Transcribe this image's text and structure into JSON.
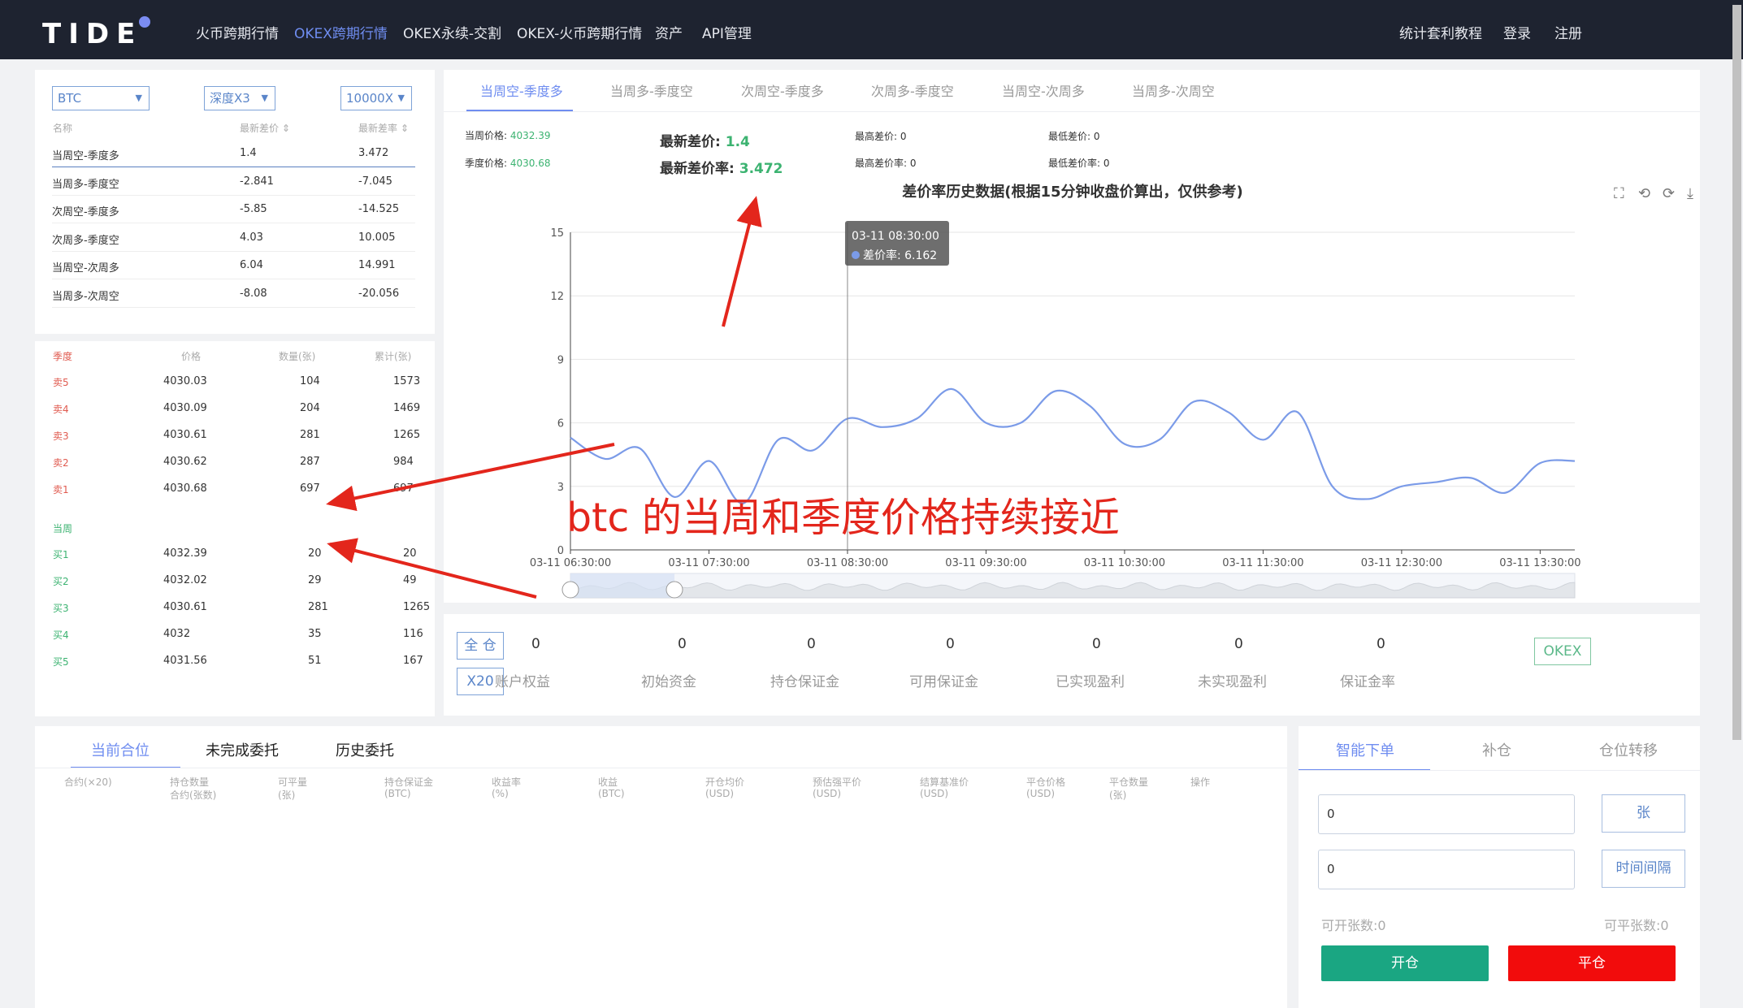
{
  "header": {
    "logo": "TIDE",
    "nav": [
      "火币跨期行情",
      "OKEX跨期行情",
      "OKEX永续-交割",
      "OKEX-火币跨期行情",
      "资产",
      "API管理"
    ],
    "active_nav": 1,
    "right": [
      "统计套利教程",
      "登录",
      "注册"
    ]
  },
  "spread_table": {
    "selects": {
      "coin": "BTC",
      "depth": "深度X3",
      "amount": "10000X"
    },
    "headers": [
      "名称",
      "最新差价 ⇕",
      "最新差率 ⇕"
    ],
    "rows": [
      {
        "name": "当周空-季度多",
        "diff": "1.4",
        "rate": "3.472"
      },
      {
        "name": "当周多-季度空",
        "diff": "-2.841",
        "rate": "-7.045"
      },
      {
        "name": "次周空-季度多",
        "diff": "-5.85",
        "rate": "-14.525"
      },
      {
        "name": "次周多-季度空",
        "diff": "4.03",
        "rate": "10.005"
      },
      {
        "name": "当周空-次周多",
        "diff": "6.04",
        "rate": "14.991"
      },
      {
        "name": "当周多-次周空",
        "diff": "-8.08",
        "rate": "-20.056"
      }
    ]
  },
  "orderbook": {
    "headers": [
      "季度",
      "价格",
      "数量(张)",
      "累计(张)"
    ],
    "asks": [
      {
        "label": "卖5",
        "price": "4030.03",
        "qty": "104",
        "total": "1573"
      },
      {
        "label": "卖4",
        "price": "4030.09",
        "qty": "204",
        "total": "1469"
      },
      {
        "label": "卖3",
        "price": "4030.61",
        "qty": "281",
        "total": "1265"
      },
      {
        "label": "卖2",
        "price": "4030.62",
        "qty": "287",
        "total": "984"
      },
      {
        "label": "卖1",
        "price": "4030.68",
        "qty": "697",
        "total": "697"
      }
    ],
    "mid_label": "当周",
    "bids": [
      {
        "label": "买1",
        "price": "4032.39",
        "qty": "20",
        "total": "20"
      },
      {
        "label": "买2",
        "price": "4032.02",
        "qty": "29",
        "total": "49"
      },
      {
        "label": "买3",
        "price": "4030.61",
        "qty": "281",
        "total": "1265"
      },
      {
        "label": "买4",
        "price": "4032",
        "qty": "35",
        "total": "116"
      },
      {
        "label": "买5",
        "price": "4031.56",
        "qty": "51",
        "total": "167"
      }
    ]
  },
  "chart_tabs": [
    "当周空-季度多",
    "当周多-季度空",
    "次周空-季度多",
    "次周多-季度空",
    "当周空-次周多",
    "当周多-次周空"
  ],
  "summary": {
    "week_price_label": "当周价格:",
    "week_price": "4032.39",
    "quarter_price_label": "季度价格:",
    "quarter_price": "4030.68",
    "latest_diff_label": "最新差价:",
    "latest_diff": "1.4",
    "latest_rate_label": "最新差价率:",
    "latest_rate": "3.472",
    "max_diff": "最高差价: 0",
    "max_rate": "最高差价率: 0",
    "min_diff": "最低差价: 0",
    "min_rate": "最低差价率: 0"
  },
  "chart_data": {
    "type": "line",
    "title": "差价率历史数据(根据15分钟收盘价算出，仅供参考)",
    "x": [
      "03-11 06:30:00",
      "03-11 06:45:00",
      "03-11 07:00:00",
      "03-11 07:15:00",
      "03-11 07:30:00",
      "03-11 07:45:00",
      "03-11 08:00:00",
      "03-11 08:15:00",
      "03-11 08:30:00",
      "03-11 08:45:00",
      "03-11 09:00:00",
      "03-11 09:15:00",
      "03-11 09:30:00",
      "03-11 09:45:00",
      "03-11 10:00:00",
      "03-11 10:15:00",
      "03-11 10:30:00",
      "03-11 10:45:00",
      "03-11 11:00:00",
      "03-11 11:15:00",
      "03-11 11:30:00",
      "03-11 11:45:00",
      "03-11 12:00:00",
      "03-11 12:15:00",
      "03-11 12:30:00",
      "03-11 12:45:00",
      "03-11 13:00:00",
      "03-11 13:15:00",
      "03-11 13:30:00",
      "03-11 13:45:00"
    ],
    "values": [
      5.3,
      4.3,
      4.8,
      2.5,
      4.2,
      2.2,
      5.2,
      4.7,
      6.2,
      5.8,
      6.2,
      7.6,
      6,
      6,
      7.5,
      6.8,
      5,
      5.2,
      7,
      6.5,
      5.2,
      6.5,
      3,
      2.4,
      3,
      3.2,
      3.4,
      2.7,
      4.1,
      4.2
    ],
    "xticks": [
      "03-11 06:30:00",
      "03-11 07:30:00",
      "03-11 08:30:00",
      "03-11 09:30:00",
      "03-11 10:30:00",
      "03-11 11:30:00",
      "03-11 12:30:00",
      "03-11 13:30:00"
    ],
    "yticks": [
      "0",
      "3",
      "6",
      "9",
      "12",
      "15"
    ],
    "ylim": [
      0,
      15
    ],
    "tooltip": {
      "time": "03-11 08:30:00",
      "label": "差价率: 6.162"
    },
    "colors": {
      "line": "#7b9be8"
    }
  },
  "positions_panel": {
    "badges": [
      "全 仓",
      "X20"
    ],
    "stats": [
      {
        "value": "0",
        "label": "账户权益"
      },
      {
        "value": "0",
        "label": "初始资金"
      },
      {
        "value": "0",
        "label": "持仓保证金"
      },
      {
        "value": "0",
        "label": "可用保证金"
      },
      {
        "value": "0",
        "label": "已实现盈利"
      },
      {
        "value": "0",
        "label": "未实现盈利"
      },
      {
        "value": "0",
        "label": "保证金率"
      }
    ],
    "exchange": "OKEX"
  },
  "orders": {
    "tabs": [
      "当前合位",
      "未完成委托",
      "历史委托"
    ],
    "columns": [
      [
        "合约(×20)",
        ""
      ],
      [
        "持仓数量",
        "合约(张数)"
      ],
      [
        "可平量",
        "(张)"
      ],
      [
        "持仓保证金",
        "(BTC)"
      ],
      [
        "收益率",
        "(%)"
      ],
      [
        "收益",
        "(BTC)"
      ],
      [
        "开仓均价",
        "(USD)"
      ],
      [
        "预估强平价",
        "(USD)"
      ],
      [
        "结算基准价",
        "(USD)"
      ],
      [
        "平仓价格",
        "(USD)"
      ],
      [
        "平仓数量",
        "(张)"
      ],
      [
        "操作",
        ""
      ]
    ]
  },
  "trade": {
    "tabs": [
      "智能下单",
      "补仓",
      "仓位转移"
    ],
    "input1": "0",
    "unit1": "张",
    "input2": "0",
    "unit2": "时间间隔",
    "open_avail": "可开张数:0",
    "close_avail": "可平张数:0",
    "open_btn": "开仓",
    "close_btn": "平仓"
  },
  "annotation": "btc 的当周和季度价格持续接近"
}
